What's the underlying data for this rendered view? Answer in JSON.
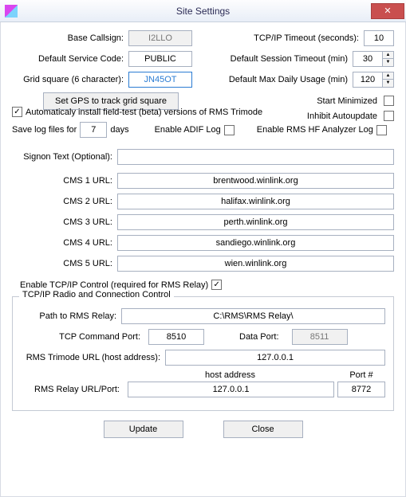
{
  "window": {
    "title": "Site Settings"
  },
  "left": {
    "base_callsign_label": "Base Callsign:",
    "base_callsign": "I2LLO",
    "service_code_label": "Default Service Code:",
    "service_code": "PUBLIC",
    "grid_label": "Grid square (6 character):",
    "grid": "JN45OT",
    "gps_button": "Set GPS to track grid square"
  },
  "right": {
    "tcp_timeout_label": "TCP/IP Timeout (seconds):",
    "tcp_timeout": "10",
    "session_timeout_label": "Default Session Timeout (min)",
    "session_timeout": "30",
    "max_daily_label": "Default Max Daily Usage (min)",
    "max_daily": "120",
    "start_minimized": "Start Minimized",
    "inhibit_autoupdate": "Inhibit Autoupdate"
  },
  "mid": {
    "auto_install_label": "Automaticaly install field-test (beta) versions of RMS Trimode",
    "save_log_label_pre": "Save log files for",
    "save_log_days": "7",
    "save_log_label_post": "days",
    "enable_adif": "Enable ADIF Log",
    "enable_rms_analyzer": "Enable RMS HF Analyzer Log"
  },
  "signon": {
    "label": "Signon Text (Optional):",
    "value": ""
  },
  "cms": [
    {
      "label": "CMS 1 URL:",
      "value": "brentwood.winlink.org"
    },
    {
      "label": "CMS 2 URL:",
      "value": "halifax.winlink.org"
    },
    {
      "label": "CMS 3 URL:",
      "value": "perth.winlink.org"
    },
    {
      "label": "CMS 4 URL:",
      "value": "sandiego.winlink.org"
    },
    {
      "label": "CMS 5 URL:",
      "value": "wien.winlink.org"
    }
  ],
  "tcpctrl": {
    "enable_label": "Enable TCP/IP Control (required for RMS Relay)",
    "group_title": "TCP/IP Radio and Connection Control",
    "path_label": "Path to RMS Relay:",
    "path": "C:\\RMS\\RMS Relay\\",
    "cmd_port_label": "TCP Command Port:",
    "cmd_port": "8510",
    "data_port_label": "Data Port:",
    "data_port": "8511",
    "trimode_url_label": "RMS Trimode URL (host address):",
    "trimode_url": "127.0.0.1",
    "host_addr_head": "host address",
    "port_head": "Port #",
    "relay_url_label": "RMS Relay URL/Port:",
    "relay_url": "127.0.0.1",
    "relay_port": "8772"
  },
  "buttons": {
    "update": "Update",
    "close": "Close"
  }
}
